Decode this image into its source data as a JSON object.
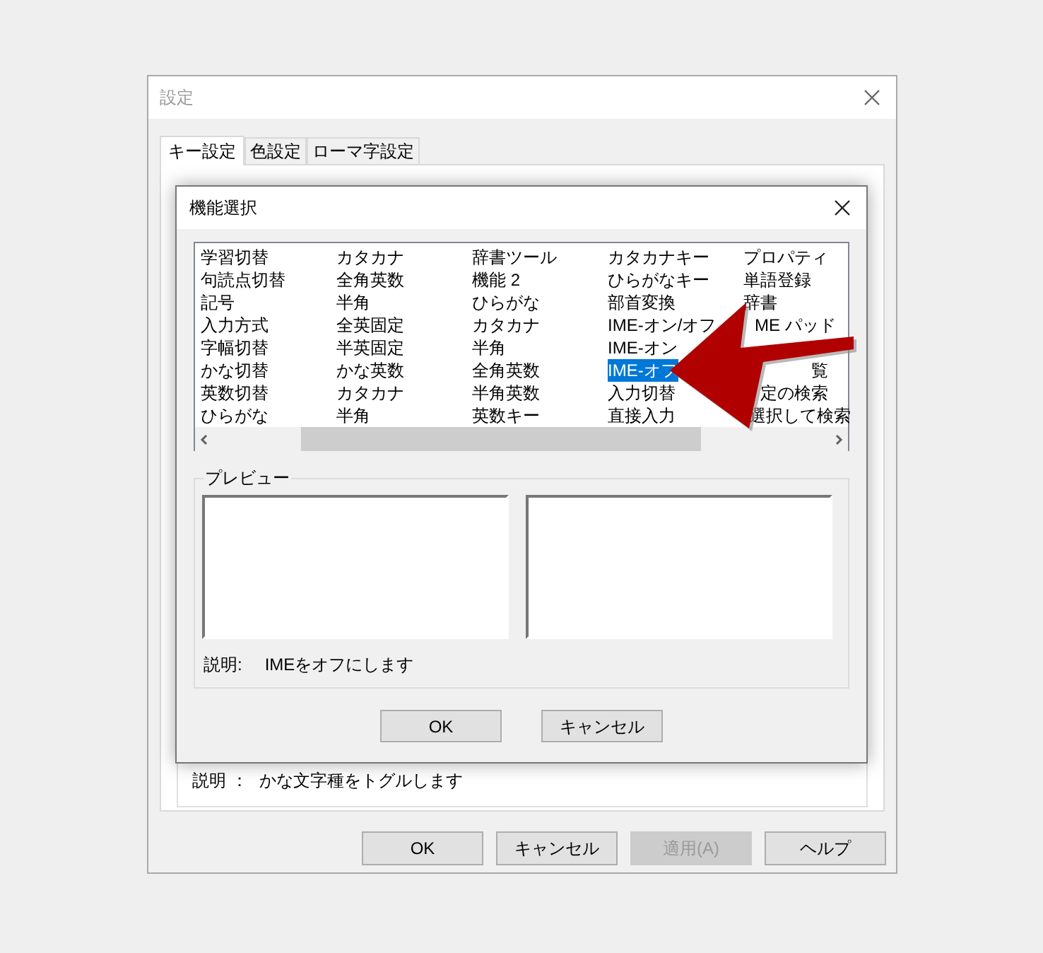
{
  "window": {
    "title": "設定"
  },
  "tabs": [
    {
      "label": "キー設定",
      "selected": true
    },
    {
      "label": "色設定",
      "selected": false
    },
    {
      "label": "ローマ字設定",
      "selected": false
    }
  ],
  "description": {
    "label": "説明 ：",
    "text": "かな文字種をトグルします"
  },
  "buttons": [
    {
      "label": "OK",
      "disabled": false
    },
    {
      "label": "キャンセル",
      "disabled": false
    },
    {
      "label": "適用(A)",
      "disabled": true
    },
    {
      "label": "ヘルプ",
      "disabled": false
    }
  ],
  "dialog": {
    "title": "機能選択",
    "list": {
      "rows": [
        [
          {
            "text": "学習切替",
            "selected": false
          },
          {
            "text": "カタカナ",
            "selected": false
          },
          {
            "text": "辞書ツール",
            "selected": false
          },
          {
            "text": "カタカナキー",
            "selected": false
          },
          {
            "text": "プロパティ",
            "selected": false
          }
        ],
        [
          {
            "text": "句読点切替",
            "selected": false
          },
          {
            "text": "全角英数",
            "selected": false
          },
          {
            "text": "機能 2",
            "selected": false
          },
          {
            "text": "ひらがなキー",
            "selected": false
          },
          {
            "text": "単語登録",
            "selected": false
          }
        ],
        [
          {
            "text": "記号",
            "selected": false
          },
          {
            "text": "半角",
            "selected": false
          },
          {
            "text": "ひらがな",
            "selected": false
          },
          {
            "text": "部首変換",
            "selected": false
          },
          {
            "text": "辞書",
            "selected": false
          }
        ],
        [
          {
            "text": "入力方式",
            "selected": false
          },
          {
            "text": "全英固定",
            "selected": false
          },
          {
            "text": "カタカナ",
            "selected": false
          },
          {
            "text": "IME-オン/オフ",
            "selected": false
          },
          {
            "text": "ME パッド",
            "selected": false
          }
        ],
        [
          {
            "text": "字幅切替",
            "selected": false
          },
          {
            "text": "半英固定",
            "selected": false
          },
          {
            "text": "半角",
            "selected": false
          },
          {
            "text": "IME-オン",
            "selected": false
          }
        ],
        [
          {
            "text": "かな切替",
            "selected": false
          },
          {
            "text": "かな英数",
            "selected": false
          },
          {
            "text": "全角英数",
            "selected": false
          },
          {
            "text": "IME-オフ",
            "selected": true
          },
          {
            "text": "覧",
            "selected": false
          }
        ],
        [
          {
            "text": "英数切替",
            "selected": false
          },
          {
            "text": "カタカナ",
            "selected": false
          },
          {
            "text": "半角英数",
            "selected": false
          },
          {
            "text": "入力切替",
            "selected": false
          },
          {
            "text": "定の検索",
            "selected": false
          }
        ],
        [
          {
            "text": "ひらがな",
            "selected": false
          },
          {
            "text": "半角",
            "selected": false
          },
          {
            "text": "英数キー",
            "selected": false
          },
          {
            "text": "直接入力",
            "selected": false
          },
          {
            "text": "選択して検索",
            "selected": false
          }
        ]
      ]
    },
    "preview": {
      "label": "プレビュー",
      "description_label": "説明:",
      "description": "IMEをオフにします"
    },
    "buttons": [
      {
        "label": "OK"
      },
      {
        "label": "キャンセル"
      }
    ]
  }
}
